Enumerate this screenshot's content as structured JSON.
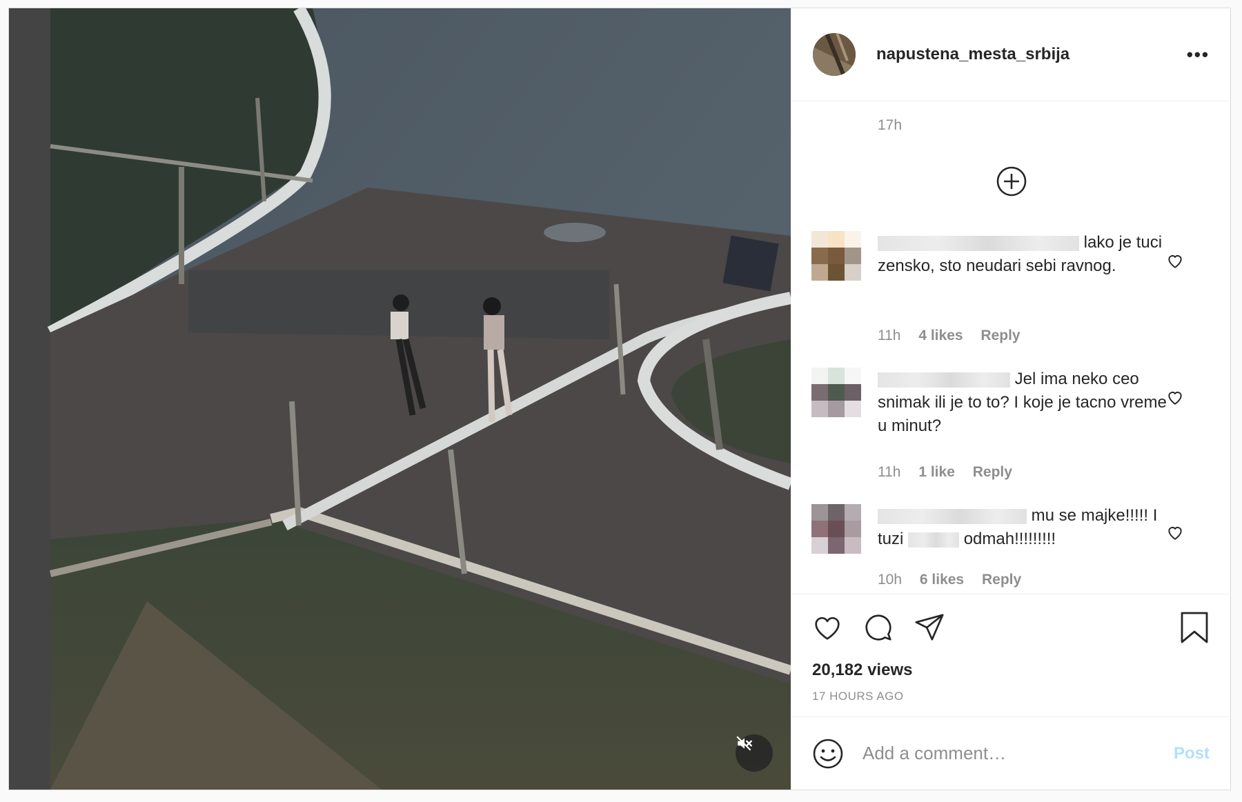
{
  "post": {
    "username": "napustena_mesta_srbija",
    "more_label": "•••",
    "caption_time": "17h",
    "views": "20,182 views",
    "posted_ago": "17 HOURS AGO"
  },
  "comments": [
    {
      "text_before": "",
      "text_after": "lako je tuci zensko, sto neudari sebi ravnog.",
      "time": "11h",
      "likes": "4 likes",
      "reply": "Reply"
    },
    {
      "text_before": "",
      "text_after": "Jel ima neko ceo snimak ili je to to? I koje je tacno vreme u minut?",
      "time": "11h",
      "likes": "1 like",
      "reply": "Reply"
    },
    {
      "text_before": "mu se majke!!!!! I tuzi",
      "text_after": "odmah!!!!!!!!!",
      "time": "10h",
      "likes": "6 likes",
      "reply": "Reply"
    }
  ],
  "add_comment": {
    "placeholder": "Add a comment…",
    "post_label": "Post"
  },
  "icons": {
    "mute": "speaker-muted-icon",
    "load_more": "plus-circle-icon",
    "like": "heart-icon",
    "comment": "speech-bubble-icon",
    "share": "paper-plane-icon",
    "save": "bookmark-icon",
    "emoji": "smiley-icon"
  },
  "colors": {
    "text": "#262626",
    "secondary": "#8e8e8e",
    "post_disabled": "#b2dffc",
    "border": "#dbdbdb"
  }
}
